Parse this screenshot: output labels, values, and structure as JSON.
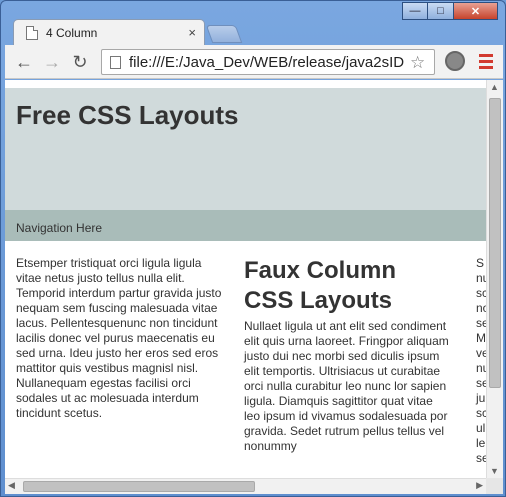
{
  "window": {
    "minimize_glyph": "—",
    "maximize_glyph": "□",
    "close_glyph": "✕"
  },
  "tabs": [
    {
      "title": "4 Column",
      "close": "×"
    }
  ],
  "toolbar": {
    "back_icon": "←",
    "forward_icon": "→",
    "reload_icon": "↻",
    "url": "file:///E:/Java_Dev/WEB/release/java2sID",
    "star_icon": "☆"
  },
  "page": {
    "header_title": "Free CSS Layouts",
    "navigation": "Navigation Here",
    "col1_text": "Etsemper tristiquat orci ligula ligula vitae netus justo tellus nulla elit. Temporid interdum partur gravida justo nequam sem fuscing malesuada vitae lacus. Pellentesquenunc non tincidunt lacilis donec vel purus maecenatis eu sed urna. Ideu justo her eros sed eros mattitor quis vestibus magnisl nisl. Nullanequam egestas facilisi orci sodales ut ac molesuada interdum tincidunt scetus.",
    "col2_heading": "Faux Column CSS Layouts",
    "col2_text": "Nullaet ligula ut ant elit sed condiment elit quis urna laoreet. Fringpor aliquam justo dui nec morbi sed diculis ipsum elit temportis. Ultrisiacus ut curabitae orci nulla curabitur leo nunc lor sapien ligula. Diamquis sagittitor quat vitae leo ipsum id vivamus sodalesuada por gravida. Sedet rutrum pellus tellus vel nonummy",
    "col3_lines": [
      "S",
      "nu",
      "sc",
      "no",
      "se",
      "M",
      "ve",
      "nu",
      "se",
      "ju",
      "sc",
      "ul",
      "le",
      "se"
    ]
  },
  "scrollbar": {
    "up": "▲",
    "down": "▼",
    "left": "◀",
    "right": "▶"
  }
}
